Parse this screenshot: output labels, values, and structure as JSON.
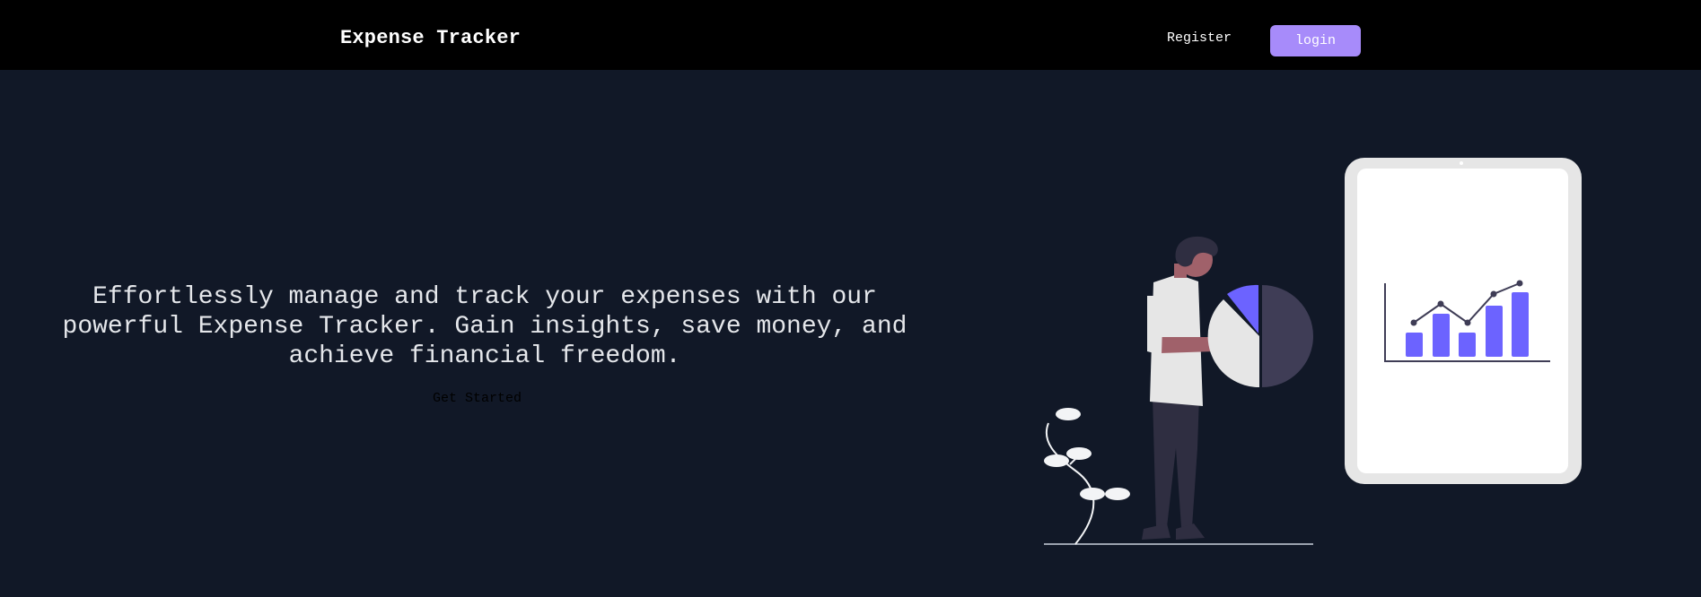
{
  "navbar": {
    "brand": "Expense Tracker",
    "register_label": "Register",
    "login_label": "login"
  },
  "hero": {
    "headline": "Effortlessly manage and track your expenses with our powerful Expense Tracker. Gain insights, save money, and achieve financial freedom.",
    "cta_label": "Get Started"
  },
  "colors": {
    "page_background": "#111827",
    "navbar_background": "#000000",
    "accent": "#a78bfa",
    "illustration_accent": "#6c63ff"
  },
  "illustration": {
    "icon": "finance-analytics-illustration"
  }
}
